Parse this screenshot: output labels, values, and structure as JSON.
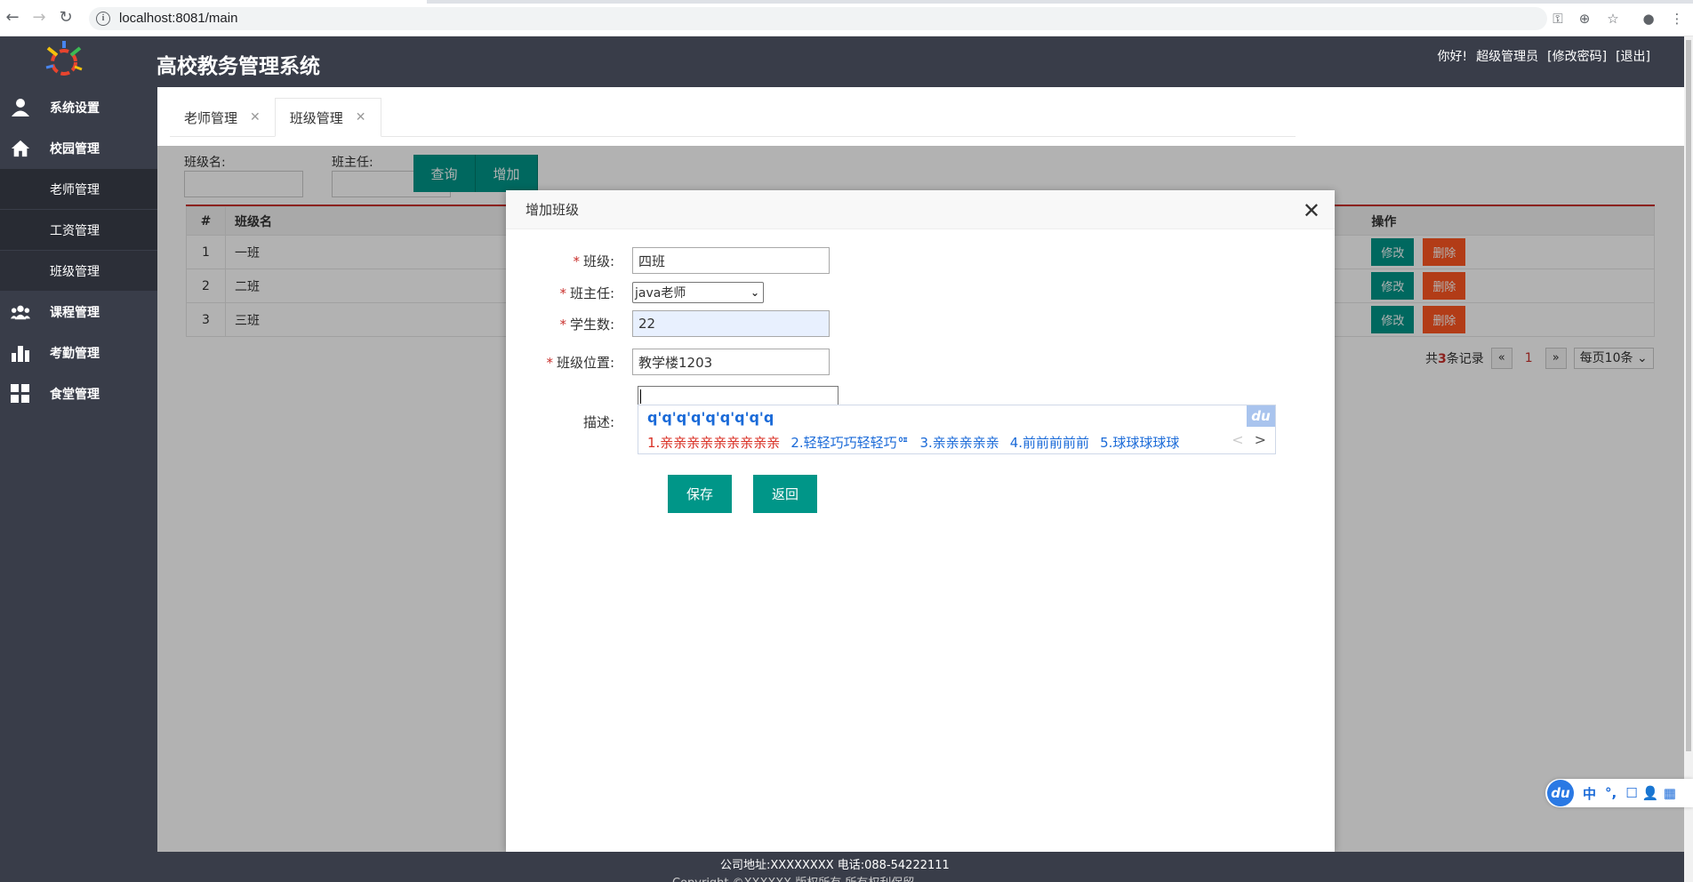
{
  "browser": {
    "url": "localhost:8081/main"
  },
  "header": {
    "title": "高校教务管理系统",
    "greeting": "你好!",
    "user": "超级管理员",
    "change_password": "[修改密码]",
    "logout": "[退出]"
  },
  "sidebar": {
    "items": [
      {
        "label": "系统设置",
        "icon": "user-icon"
      },
      {
        "label": "校园管理",
        "icon": "home-icon"
      },
      {
        "label": "老师管理"
      },
      {
        "label": "工资管理"
      },
      {
        "label": "班级管理"
      },
      {
        "label": "课程管理",
        "icon": "group-icon"
      },
      {
        "label": "考勤管理",
        "icon": "bar-chart-icon"
      },
      {
        "label": "食堂管理",
        "icon": "grid-icon"
      }
    ]
  },
  "tabs": [
    {
      "label": "老师管理",
      "close": "✕"
    },
    {
      "label": "班级管理",
      "close": "✕"
    }
  ],
  "search": {
    "class_name_label": "班级名:",
    "head_teacher_label": "班主任:",
    "query_button": "查询",
    "add_button": "增加"
  },
  "table": {
    "headers": {
      "index": "#",
      "name": "班级名",
      "ops": "操作"
    },
    "rows": [
      {
        "index": "1",
        "name": "一班"
      },
      {
        "index": "2",
        "name": "二班"
      },
      {
        "index": "3",
        "name": "三班"
      }
    ],
    "edit_label": "修改",
    "delete_label": "删除"
  },
  "pager": {
    "total_prefix": "共",
    "total_count": "3",
    "total_suffix": "条记录",
    "prev": "«",
    "current": "1",
    "next": "»",
    "page_size": "每页10条"
  },
  "modal": {
    "title": "增加班级",
    "close": "✕",
    "fields": {
      "class_label": "班级:",
      "class_value": "四班",
      "teacher_label": "班主任:",
      "teacher_value": "java老师",
      "students_label": "学生数:",
      "students_value": "22",
      "location_label": "班级位置:",
      "location_value": "教学楼1203",
      "desc_label": "描述:"
    },
    "required_mark": "*",
    "save_button": "保存",
    "back_button": "返回"
  },
  "ime_popup": {
    "composition": "q'q'q'q'q'q'q'q'q",
    "badge": "du",
    "candidates": [
      "1.亲亲亲亲亲亲亲亲亲",
      "2.轻轻巧巧轻轻巧ᅋ",
      "3.亲亲亲亲亲",
      "4.前前前前前",
      "5.球球球球球"
    ],
    "prev": "<",
    "next": ">"
  },
  "ime_status": {
    "logo": "du",
    "mode": "中",
    "punct": "°,",
    "tools": "☐ 👤 ▦"
  },
  "footer": {
    "address": "公司地址:XXXXXXXX 电话:088-54222111",
    "second_line": "Copyright ©XXXXXX 版权所有 所有权利保留"
  }
}
